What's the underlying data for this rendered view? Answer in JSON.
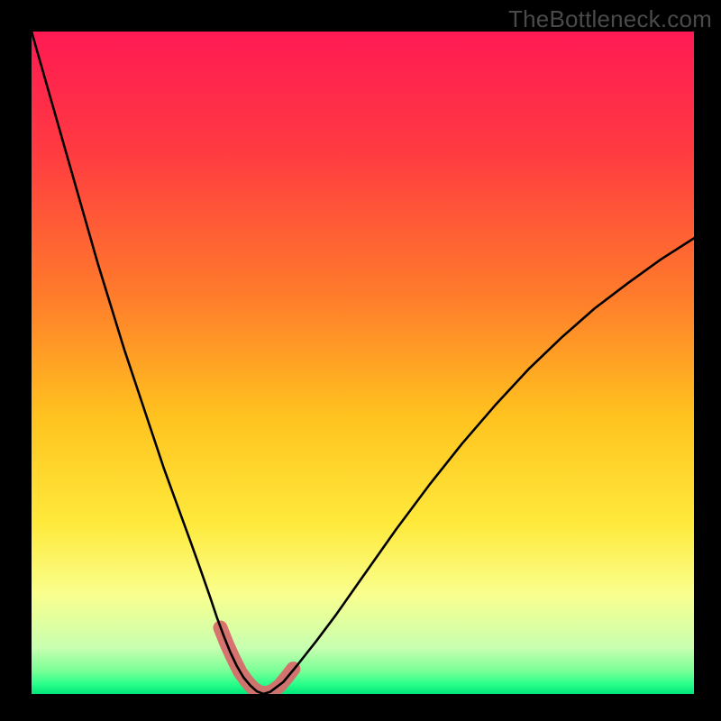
{
  "watermark": "TheBottleneck.com",
  "chart_data": {
    "type": "line",
    "title": "",
    "xlabel": "",
    "ylabel": "",
    "xlim": [
      0,
      100
    ],
    "ylim": [
      0,
      100
    ],
    "grid": false,
    "legend": false,
    "series": [
      {
        "name": "curve",
        "x": [
          0,
          2,
          4,
          6,
          8,
          10,
          12,
          14,
          16,
          18,
          20,
          22,
          24,
          25.5,
          27,
          28,
          29,
          30,
          31,
          32,
          33,
          34,
          35,
          36,
          38,
          40,
          43,
          46,
          50,
          55,
          60,
          65,
          70,
          75,
          80,
          85,
          90,
          95,
          100
        ],
        "y": [
          100,
          93,
          86,
          79,
          72,
          65,
          58.5,
          52,
          46,
          40,
          34,
          28.5,
          23,
          18.8,
          14.5,
          11.5,
          8.8,
          6.3,
          4.2,
          2.5,
          1.3,
          0.4,
          0,
          0.3,
          1.8,
          4.2,
          8.0,
          12.0,
          17.7,
          24.8,
          31.5,
          37.8,
          43.6,
          49.0,
          53.8,
          58.2,
          62.0,
          65.6,
          68.8
        ]
      },
      {
        "name": "highlight",
        "x": [
          28.5,
          29.5,
          30.5,
          31.5,
          32.5,
          33.5,
          34.5,
          35.5,
          36.5,
          37.5,
          38.5,
          39.5
        ],
        "y": [
          10.0,
          7.5,
          5.3,
          3.3,
          1.9,
          0.8,
          0.2,
          0.1,
          0.5,
          1.3,
          2.5,
          3.8
        ]
      }
    ],
    "background_gradient": {
      "stops": [
        {
          "pos": 0.0,
          "color": "#ff1a54"
        },
        {
          "pos": 0.18,
          "color": "#ff3a41"
        },
        {
          "pos": 0.4,
          "color": "#ff7c2b"
        },
        {
          "pos": 0.58,
          "color": "#ffc21f"
        },
        {
          "pos": 0.74,
          "color": "#ffe93a"
        },
        {
          "pos": 0.85,
          "color": "#f9ff8e"
        },
        {
          "pos": 0.93,
          "color": "#c8ffb0"
        },
        {
          "pos": 0.965,
          "color": "#7aff97"
        },
        {
          "pos": 0.985,
          "color": "#2aff8a"
        },
        {
          "pos": 1.0,
          "color": "#00e57a"
        }
      ]
    },
    "styles": {
      "curve": {
        "stroke": "#000000",
        "width": 2.6
      },
      "highlight": {
        "stroke": "#d86b6b",
        "width": 16,
        "linecap": "round",
        "opacity": 0.95
      }
    }
  }
}
